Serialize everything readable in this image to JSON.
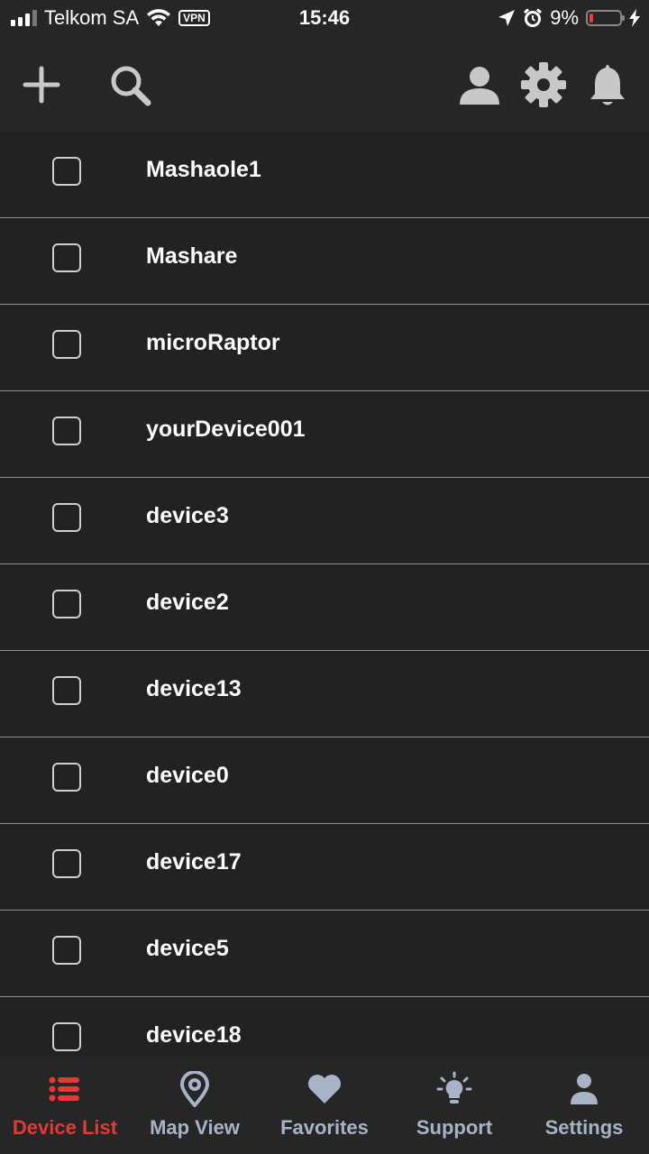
{
  "status_bar": {
    "carrier": "Telkom SA",
    "vpn": "VPN",
    "time": "15:46",
    "battery_percent": "9%",
    "battery_level": 0.09
  },
  "toolbar": {
    "icons": [
      "plus-icon",
      "search-icon",
      "user-icon",
      "gear-icon",
      "bell-icon"
    ]
  },
  "devices": [
    "Mashaole1",
    "Mashare",
    "microRaptor",
    "yourDevice001",
    "device3",
    "device2",
    "device13",
    "device0",
    "device17",
    "device5",
    "device18"
  ],
  "tabs": [
    {
      "label": "Device List",
      "icon": "list-icon",
      "active": true
    },
    {
      "label": "Map View",
      "icon": "map-pin-icon",
      "active": false
    },
    {
      "label": "Favorites",
      "icon": "heart-icon",
      "active": false
    },
    {
      "label": "Support",
      "icon": "lightbulb-icon",
      "active": false
    },
    {
      "label": "Settings",
      "icon": "person-icon",
      "active": false
    }
  ],
  "colors": {
    "background": "#222222",
    "bar": "#262626",
    "accent": "#e53935",
    "tab_inactive": "#a9b3c7",
    "toolbar_icon": "#c8c8c8"
  }
}
